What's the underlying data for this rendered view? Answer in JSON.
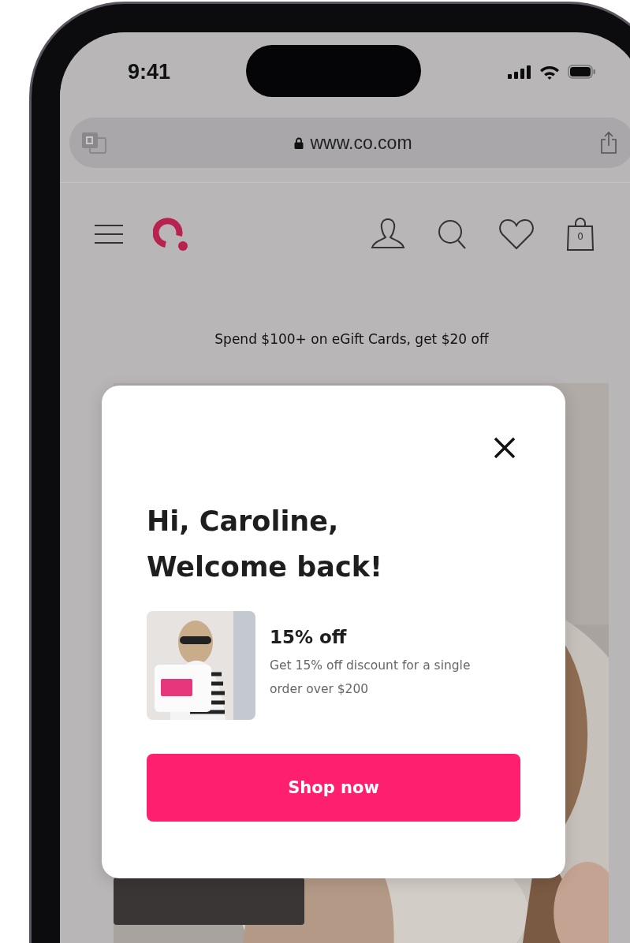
{
  "status_bar": {
    "time": "9:41"
  },
  "browser": {
    "url": "www.co.com"
  },
  "header": {
    "cart_count": "0"
  },
  "announcement": "Spend $100+ on eGift Cards, get $20 off",
  "modal": {
    "greeting": "Hi, Caroline,",
    "heading": "Welcome back!",
    "offer": {
      "title": "15% off",
      "description": "Get 15% off discount for a single order over $200"
    },
    "button": "Shop now"
  }
}
